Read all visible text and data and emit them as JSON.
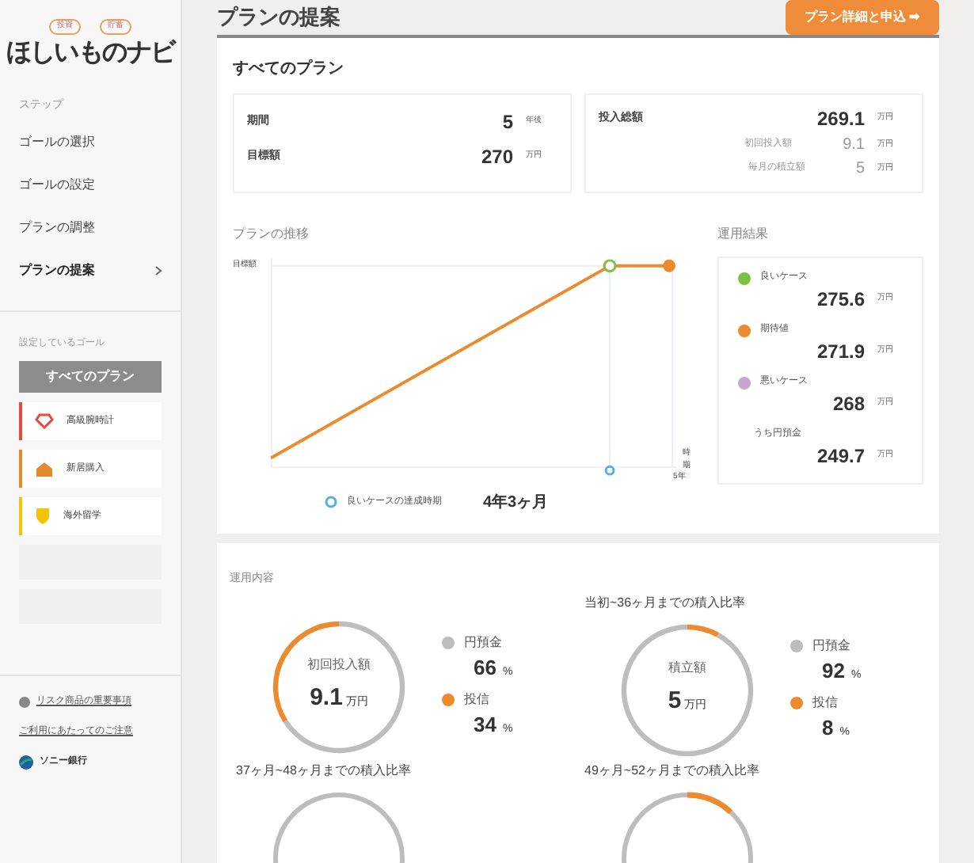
{
  "sidebar": {
    "logo": {
      "bubbles": [
        "投資",
        "貯蓄"
      ],
      "title": "ほしいものナビ"
    },
    "steps_label": "ステップ",
    "steps": [
      {
        "label": "ゴールの選択",
        "selected": false
      },
      {
        "label": "ゴールの設定",
        "selected": false
      },
      {
        "label": "プランの調整",
        "selected": false
      },
      {
        "label": "プランの提案",
        "selected": true
      }
    ],
    "goals_label": "設定しているゴール",
    "all_plans": "すべてのプラン",
    "goals": [
      {
        "label": "高級腕時計",
        "color": "#e8493c",
        "kind": "gem"
      },
      {
        "label": "新居購入",
        "color": "#e58a2c",
        "kind": "house"
      },
      {
        "label": "海外留学",
        "color": "#f2c500",
        "kind": "shield"
      }
    ],
    "links": [
      "リスク商品の重要事項",
      "ご利用にあたってのご注意"
    ],
    "bank": "ソニー銀行"
  },
  "header": {
    "title": "プランの提案",
    "button": "プラン詳細と申込 ➡"
  },
  "summary": {
    "title": "すべてのプラン",
    "left": [
      {
        "label": "期間",
        "value": "5",
        "unit": "年後"
      },
      {
        "label": "目標額",
        "value": "270",
        "unit": "万円"
      }
    ],
    "right": [
      {
        "label": "投入総額",
        "value": "269.1",
        "unit": "万円",
        "kind": "main"
      },
      {
        "label": "初回投入額",
        "value": "9.1",
        "unit": "万円",
        "kind": "sub"
      },
      {
        "label": "毎月の積立額",
        "value": "5",
        "unit": "万円",
        "kind": "sub"
      }
    ]
  },
  "chart": {
    "title": "プランの推移",
    "ylabel": "目標額",
    "xlabel": "時期",
    "xtick": "5年",
    "legend": "良いケースの達成時期",
    "legend_value": "4年3ヶ月"
  },
  "results": {
    "title": "運用結果",
    "items": [
      {
        "label": "良いケース",
        "value": "275.6",
        "unit": "万円",
        "color": "#7cc242"
      },
      {
        "label": "期待値",
        "value": "271.9",
        "unit": "万円",
        "color": "#ee8a2e"
      },
      {
        "label": "悪いケース",
        "value": "268",
        "unit": "万円",
        "color": "#c9a3cf"
      },
      {
        "label": "うち円預金",
        "value": "249.7",
        "unit": "万円"
      }
    ]
  },
  "breakdown": {
    "title": "運用内容",
    "donuts": [
      {
        "center_label": "初回投入額",
        "value": "9.1",
        "unit": "万円",
        "chart_data": {
          "type": "donut",
          "categories": [
            "円預金",
            "投信"
          ],
          "values": [
            66,
            34
          ]
        },
        "legend": [
          {
            "value": "66",
            "unit": "%",
            "color": "#bdbdbd"
          },
          {
            "value": "34",
            "unit": "%",
            "color": "#ee8a2e"
          }
        ]
      },
      {
        "heading": "当初~36ヶ月までの積入比率",
        "center_label": "積立額",
        "value": "5",
        "unit": "万円",
        "chart_data": {
          "type": "donut",
          "categories": [
            "円預金",
            "投信"
          ],
          "values": [
            92,
            8
          ]
        },
        "legend": [
          {
            "value": "92",
            "unit": "%",
            "color": "#bdbdbd"
          },
          {
            "value": "8",
            "unit": "%",
            "color": "#ee8a2e"
          }
        ]
      },
      {
        "heading": "37ヶ月~48ヶ月までの積入比率",
        "kind": "plain"
      },
      {
        "heading": "49ヶ月~52ヶ月までの積入比率",
        "kind": "partial"
      }
    ]
  }
}
